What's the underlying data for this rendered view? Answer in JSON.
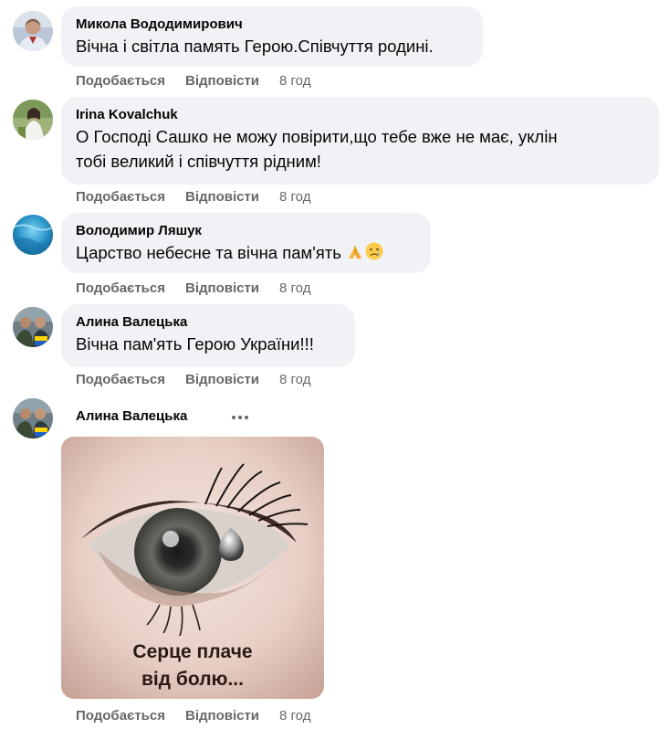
{
  "actions": {
    "like_label": "Подобається",
    "reply_label": "Відповісти"
  },
  "comments": [
    {
      "author": "Микола Вододимирович",
      "text": "Вічна і світла память Герою.Співчуття родині.",
      "time": "8 год"
    },
    {
      "author": "Irina Kovalchuk",
      "text": "О Господі Сашко не можу повірити,що тебе вже не має, уклін тобі великий і співчуття рідним!",
      "text_line1": "О Господі Сашко не можу повірити,що тебе вже не має, уклін",
      "text_line2": "тобі великий і співчуття рідним!",
      "time": "8 год"
    },
    {
      "author": "Володимир Ляшук",
      "text": "Царство небесне та вічна пам'ять",
      "emojis": [
        "folded-hands",
        "sad-face"
      ],
      "time": "8 год"
    },
    {
      "author": "Алина Валецька",
      "text": "Вічна пам'ять Герою України!!!",
      "time": "8 год"
    },
    {
      "author": "Алина Валецька",
      "image_caption_line1": "Серце плаче",
      "image_caption_line2": "від болю...",
      "time": "8 год"
    }
  ],
  "colors": {
    "bubble": "#f0f2f5",
    "meta_text": "#65676b",
    "text": "#050505"
  }
}
